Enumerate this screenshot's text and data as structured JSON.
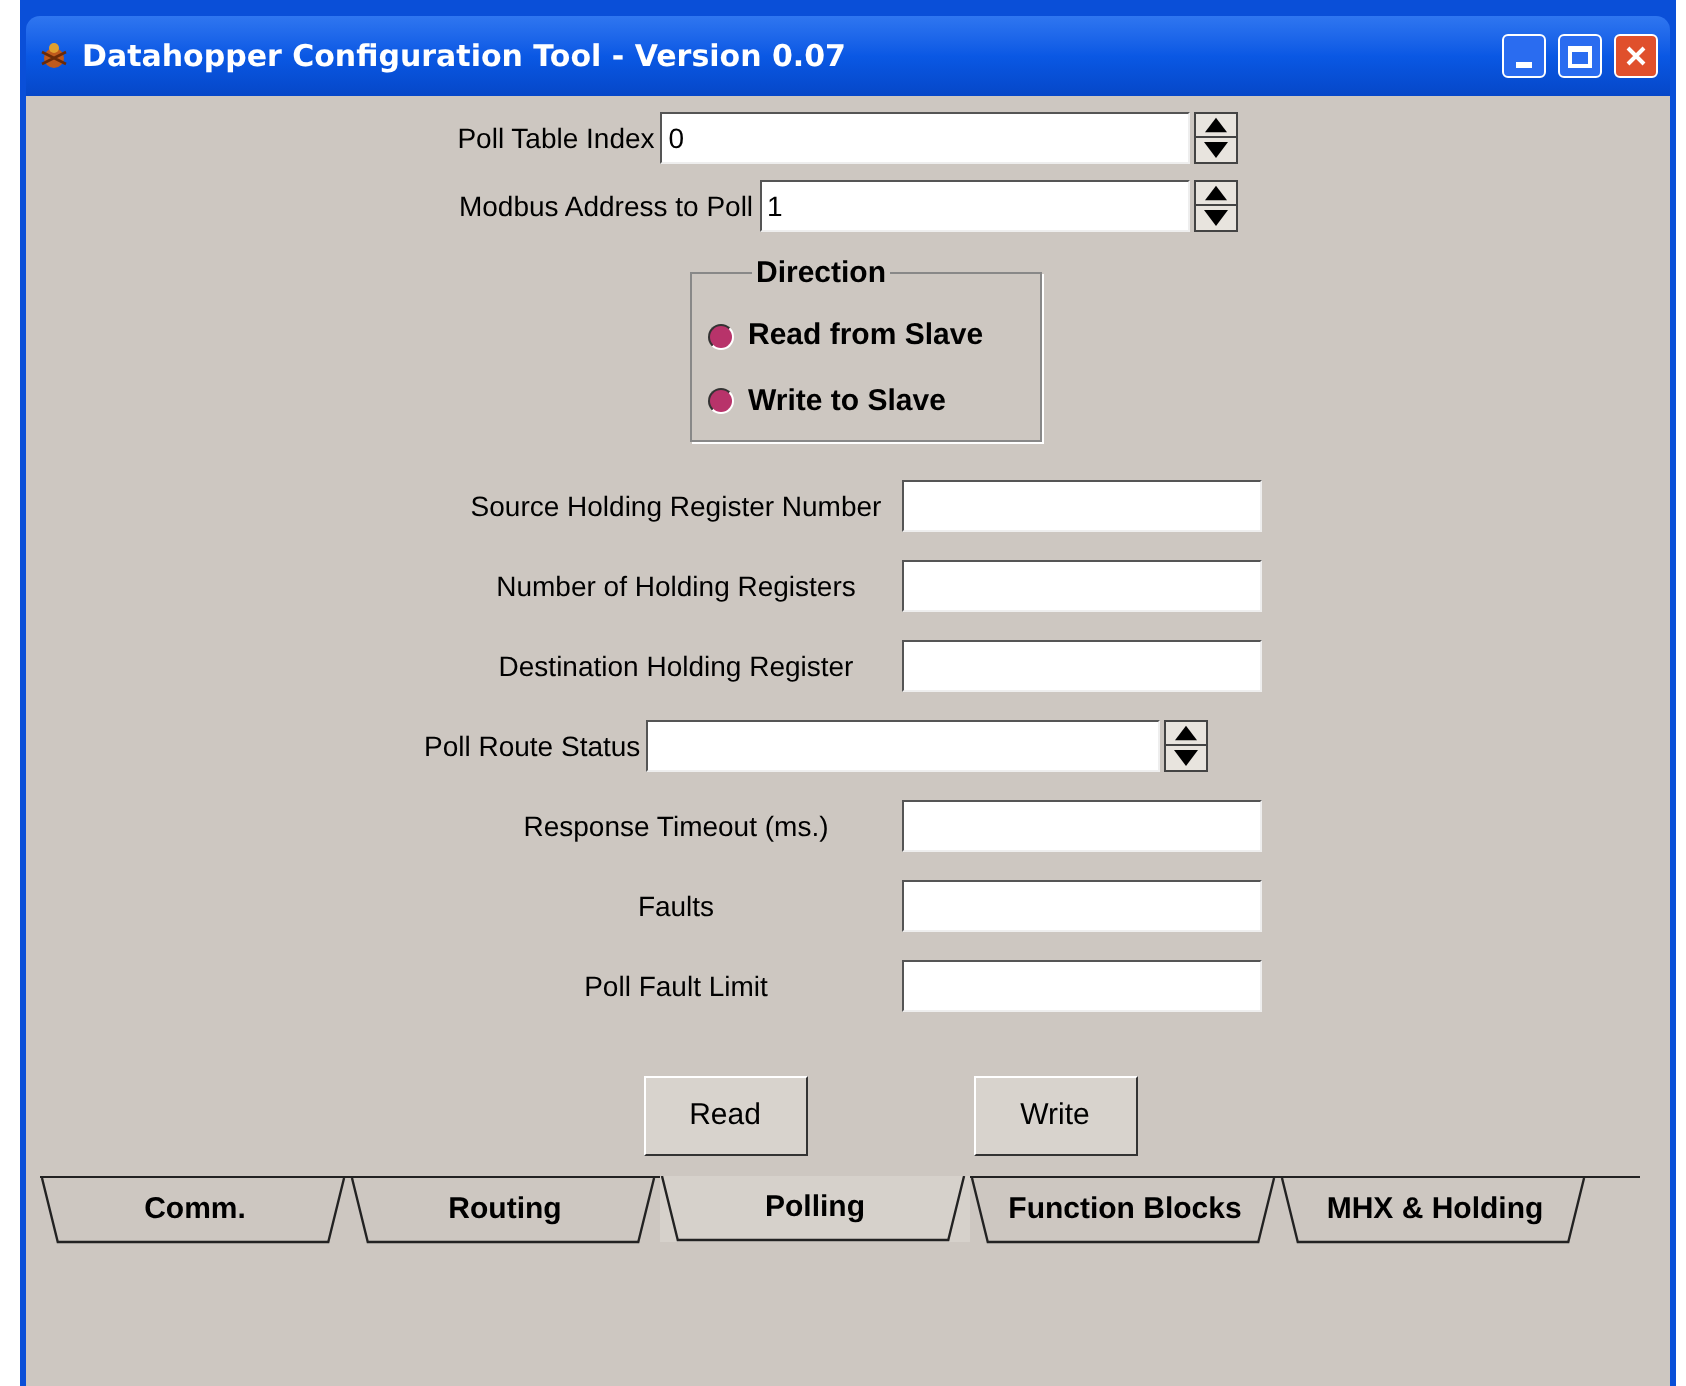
{
  "window": {
    "title": "Datahopper Configuration Tool - Version 0.07"
  },
  "spin_fields": [
    {
      "label": "Poll Table Index",
      "value": "0"
    },
    {
      "label": "Modbus Address to Poll",
      "value": "1"
    }
  ],
  "direction": {
    "title": "Direction",
    "options": [
      {
        "label": "Read from Slave",
        "selected": false
      },
      {
        "label": "Write to Slave",
        "selected": false
      }
    ]
  },
  "fields": [
    {
      "kind": "text",
      "label": "Source Holding Register Number"
    },
    {
      "kind": "text",
      "label": "Number of Holding Registers"
    },
    {
      "kind": "text",
      "label": "Destination Holding Register"
    },
    {
      "kind": "spin",
      "label": "Poll Route Status"
    },
    {
      "kind": "text",
      "label": "Response Timeout (ms.)"
    },
    {
      "kind": "text",
      "label": "Faults"
    },
    {
      "kind": "text",
      "label": "Poll Fault Limit"
    }
  ],
  "buttons": [
    "Read",
    "Write"
  ],
  "tabs": [
    {
      "label": "Comm.",
      "selected": false
    },
    {
      "label": "Routing",
      "selected": false
    },
    {
      "label": "Polling",
      "selected": true
    },
    {
      "label": "Function Blocks",
      "selected": false
    },
    {
      "label": "MHX & Holding",
      "selected": false
    }
  ]
}
